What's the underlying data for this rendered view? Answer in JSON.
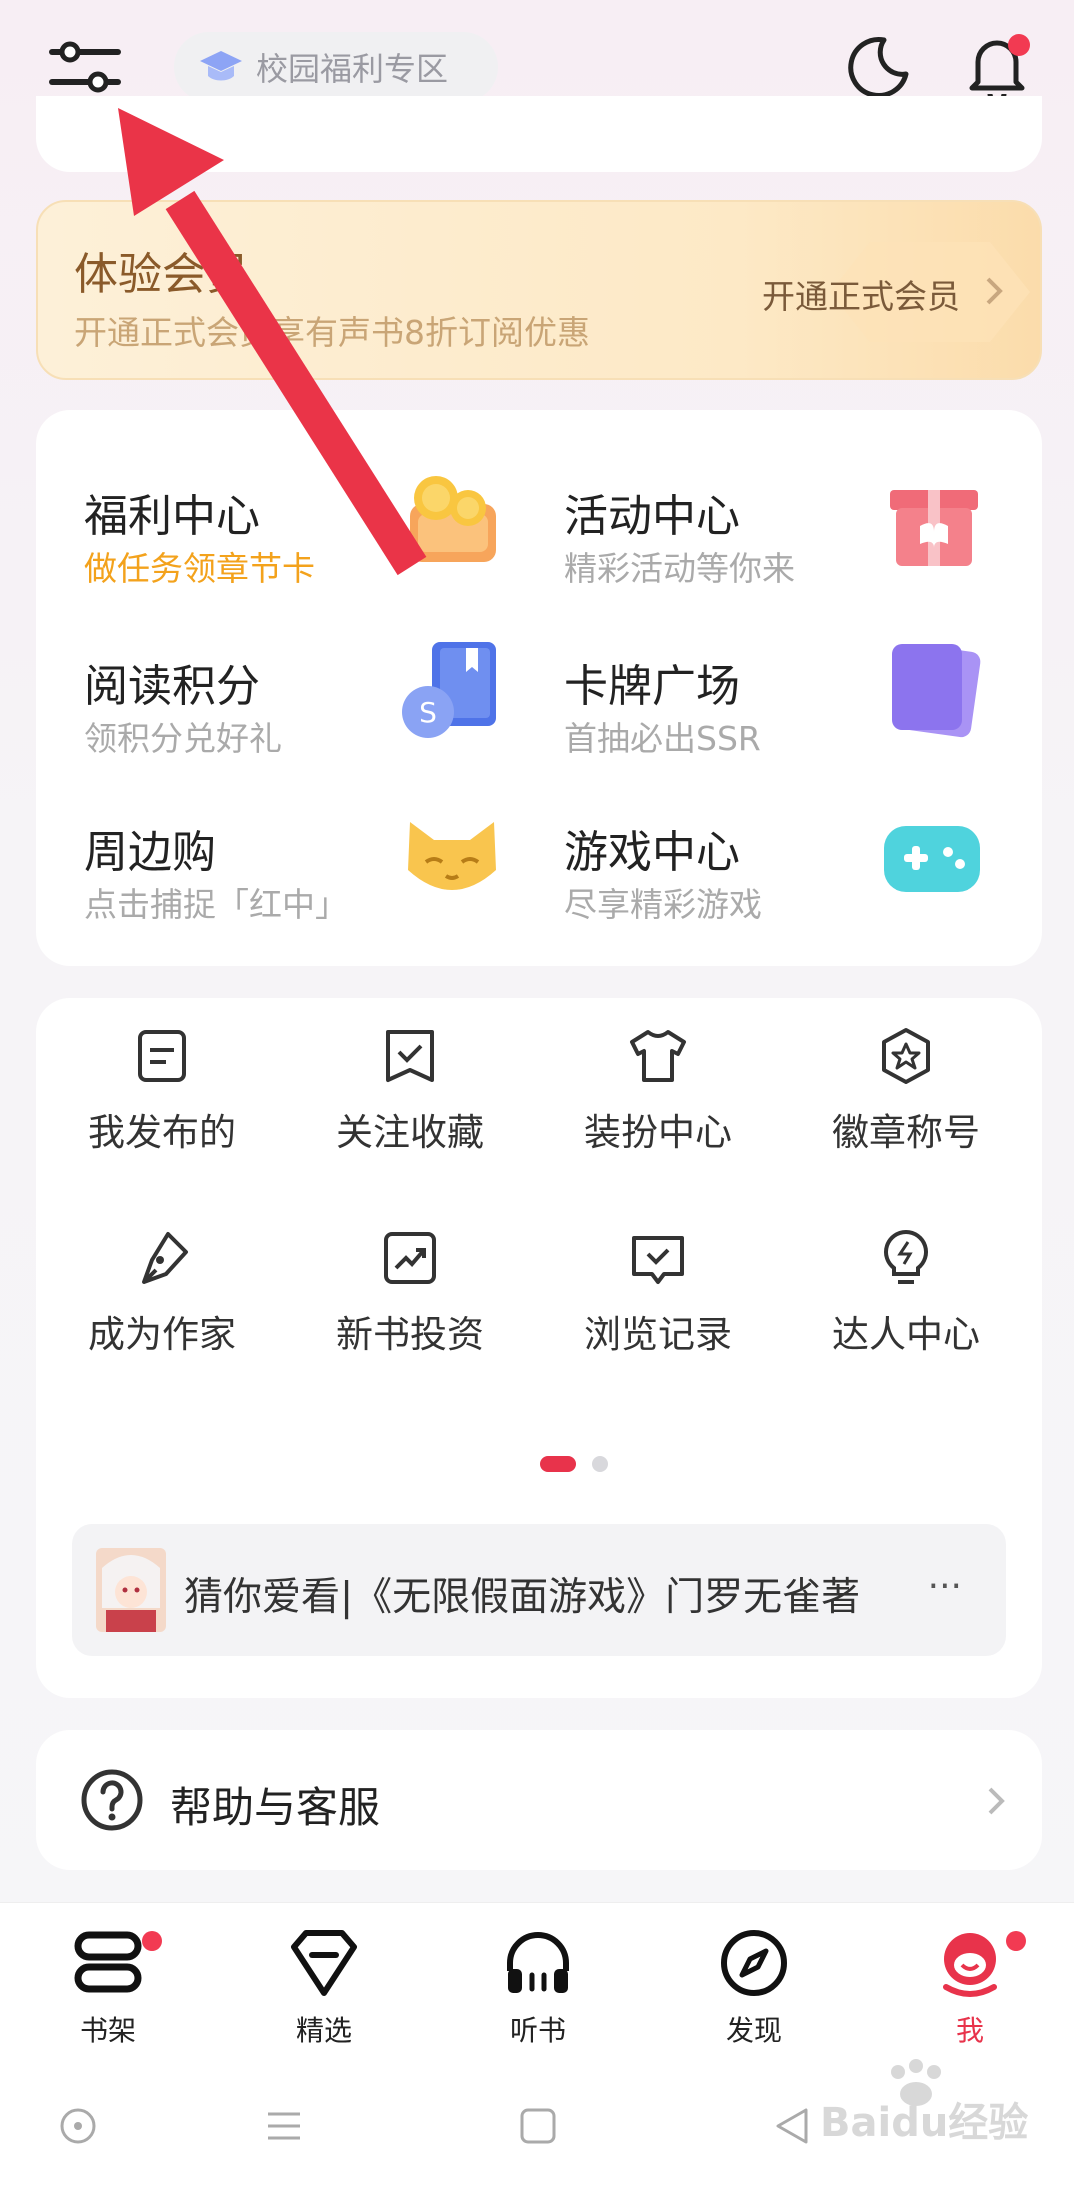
{
  "header": {
    "campus_label": "校园福利专区",
    "icons": [
      "settings-icon",
      "graduation-cap-icon",
      "moon-icon",
      "bell-icon"
    ]
  },
  "member": {
    "title": "体验会员",
    "subtitle": "开通正式会员享有声书8折订阅优惠",
    "cta": "开通正式会员"
  },
  "features": [
    {
      "name": "福利中心",
      "desc": "做任务领章节卡",
      "icon": "coin-basket-icon"
    },
    {
      "name": "活动中心",
      "desc": "精彩活动等你来",
      "icon": "gift-box-icon"
    },
    {
      "name": "阅读积分",
      "desc": "领积分兑好礼",
      "icon": "points-book-icon"
    },
    {
      "name": "卡牌广场",
      "desc": "首抽必出SSR",
      "icon": "card-icon"
    },
    {
      "name": "周边购",
      "desc": "点击捕捉「红中」",
      "icon": "fox-mascot-icon"
    },
    {
      "name": "游戏中心",
      "desc": "尽享精彩游戏",
      "icon": "gamepad-icon"
    }
  ],
  "tools": [
    {
      "label": "我发布的",
      "icon": "document-icon"
    },
    {
      "label": "关注收藏",
      "icon": "bookmark-check-icon"
    },
    {
      "label": "装扮中心",
      "icon": "shirt-icon"
    },
    {
      "label": "徽章称号",
      "icon": "badge-star-icon"
    },
    {
      "label": "成为作家",
      "icon": "pen-icon"
    },
    {
      "label": "新书投资",
      "icon": "trend-icon"
    },
    {
      "label": "浏览记录",
      "icon": "history-icon"
    },
    {
      "label": "达人中心",
      "icon": "bulb-icon"
    }
  ],
  "pager": {
    "pages": 2,
    "active": 1
  },
  "recommendation": {
    "text": "猜你爱看|《无限假面游戏》门罗无雀著",
    "more": "···"
  },
  "help": {
    "label": "帮助与客服"
  },
  "bottom_nav": [
    {
      "label": "书架",
      "icon": "bookshelf-icon",
      "badge": true
    },
    {
      "label": "精选",
      "icon": "diamond-icon",
      "badge": false
    },
    {
      "label": "听书",
      "icon": "headphones-icon",
      "badge": false
    },
    {
      "label": "发现",
      "icon": "compass-icon",
      "badge": false
    },
    {
      "label": "我",
      "icon": "profile-mascot-icon",
      "badge": true,
      "active": true
    }
  ],
  "colors": {
    "accent": "#e8334b",
    "orange": "#f3a21c",
    "member_text": "#8a5a2a"
  },
  "watermark": "Baidu经验"
}
